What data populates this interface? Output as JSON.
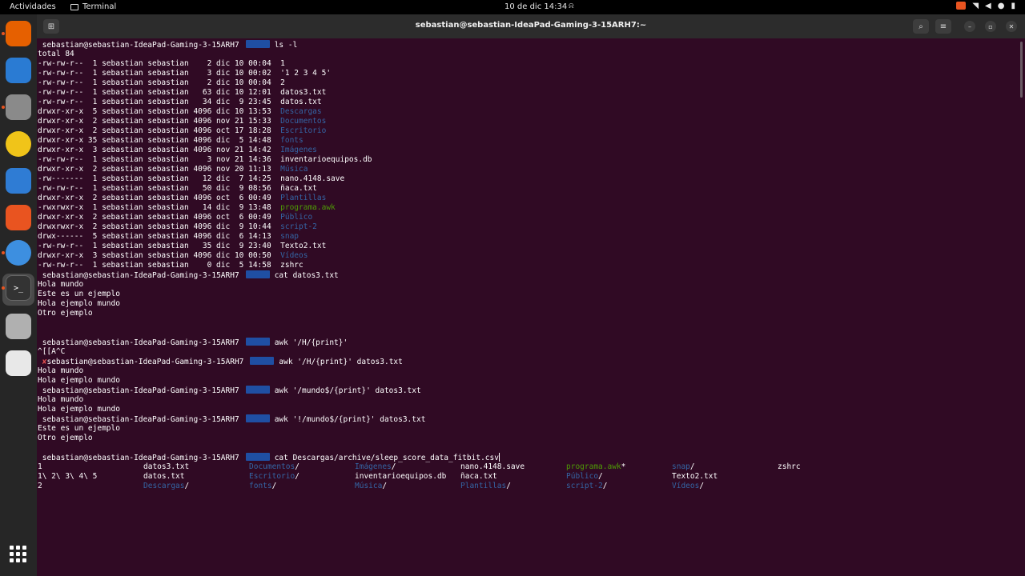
{
  "topbar": {
    "activities": "Actividades",
    "app_name": "Terminal",
    "clock": "10 de dic  14:34"
  },
  "window": {
    "title": "sebastian@sebastian-IdeaPad-Gaming-3-15ARH7:~"
  },
  "terminal": {
    "prompt": "sebastian@sebastian-IdeaPad-Gaming-3-15ARH7",
    "lines": [
      {
        "kind": "prompt",
        "cmd": "ls -l"
      },
      {
        "kind": "text",
        "text": "total 84"
      },
      {
        "kind": "ls",
        "meta": "-rw-rw-r--  1 sebastian sebastian    2 dic 10 00:04",
        "name": "1",
        "style": "plain"
      },
      {
        "kind": "ls",
        "meta": "-rw-rw-r--  1 sebastian sebastian    3 dic 10 00:02",
        "name": "'1 2 3 4 5'",
        "style": "plain"
      },
      {
        "kind": "ls",
        "meta": "-rw-rw-r--  1 sebastian sebastian    2 dic 10 00:04",
        "name": "2",
        "style": "plain"
      },
      {
        "kind": "ls",
        "meta": "-rw-rw-r--  1 sebastian sebastian   63 dic 10 12:01",
        "name": "datos3.txt",
        "style": "plain"
      },
      {
        "kind": "ls",
        "meta": "-rw-rw-r--  1 sebastian sebastian   34 dic  9 23:45",
        "name": "datos.txt",
        "style": "plain"
      },
      {
        "kind": "ls",
        "meta": "drwxr-xr-x  5 sebastian sebastian 4096 dic 10 13:53",
        "name": "Descargas",
        "style": "dir"
      },
      {
        "kind": "ls",
        "meta": "drwxr-xr-x  2 sebastian sebastian 4096 nov 21 15:33",
        "name": "Documentos",
        "style": "dir"
      },
      {
        "kind": "ls",
        "meta": "drwxr-xr-x  2 sebastian sebastian 4096 oct 17 18:28",
        "name": "Escritorio",
        "style": "dir"
      },
      {
        "kind": "ls",
        "meta": "drwxr-xr-x 35 sebastian sebastian 4096 dic  5 14:48",
        "name": "fonts",
        "style": "dir"
      },
      {
        "kind": "ls",
        "meta": "drwxr-xr-x  3 sebastian sebastian 4096 nov 21 14:42",
        "name": "Imágenes",
        "style": "dir"
      },
      {
        "kind": "ls",
        "meta": "-rw-rw-r--  1 sebastian sebastian    3 nov 21 14:36",
        "name": "inventarioequipos.db",
        "style": "plain"
      },
      {
        "kind": "ls",
        "meta": "drwxr-xr-x  2 sebastian sebastian 4096 nov 20 11:13",
        "name": "Música",
        "style": "dir"
      },
      {
        "kind": "ls",
        "meta": "-rw-------  1 sebastian sebastian   12 dic  7 14:25",
        "name": "nano.4148.save",
        "style": "plain"
      },
      {
        "kind": "ls",
        "meta": "-rw-rw-r--  1 sebastian sebastian   50 dic  9 08:56",
        "name": "ñaca.txt",
        "style": "plain"
      },
      {
        "kind": "ls",
        "meta": "drwxr-xr-x  2 sebastian sebastian 4096 oct  6 00:49",
        "name": "Plantillas",
        "style": "dir"
      },
      {
        "kind": "ls",
        "meta": "-rwxrwxr-x  1 sebastian sebastian   14 dic  9 13:48",
        "name": "programa.awk",
        "style": "exec"
      },
      {
        "kind": "ls",
        "meta": "drwxr-xr-x  2 sebastian sebastian 4096 oct  6 00:49",
        "name": "Público",
        "style": "dir"
      },
      {
        "kind": "ls",
        "meta": "drwxrwxr-x  2 sebastian sebastian 4096 dic  9 10:44",
        "name": "script-2",
        "style": "dir"
      },
      {
        "kind": "ls",
        "meta": "drwx------  5 sebastian sebastian 4096 dic  6 14:13",
        "name": "snap",
        "style": "dir"
      },
      {
        "kind": "ls",
        "meta": "-rw-rw-r--  1 sebastian sebastian   35 dic  9 23:40",
        "name": "Texto2.txt",
        "style": "plain"
      },
      {
        "kind": "ls",
        "meta": "drwxr-xr-x  3 sebastian sebastian 4096 dic 10 00:50",
        "name": "Vídeos",
        "style": "dir"
      },
      {
        "kind": "ls",
        "meta": "-rw-rw-r--  1 sebastian sebastian    0 dic  5 14:58",
        "name": "zshrc",
        "style": "plain"
      },
      {
        "kind": "prompt",
        "cmd": "cat datos3.txt"
      },
      {
        "kind": "text",
        "text": "Hola mundo"
      },
      {
        "kind": "text",
        "text": "Este es un ejemplo"
      },
      {
        "kind": "text",
        "text": "Hola ejemplo mundo"
      },
      {
        "kind": "text",
        "text": "Otro ejemplo"
      },
      {
        "kind": "blank"
      },
      {
        "kind": "blank"
      },
      {
        "kind": "prompt",
        "cmd": "awk '/H/{print}'"
      },
      {
        "kind": "text",
        "text": "^[[A^C"
      },
      {
        "kind": "prompt_err",
        "cmd": "awk '/H/{print}' datos3.txt"
      },
      {
        "kind": "text",
        "text": "Hola mundo"
      },
      {
        "kind": "text",
        "text": "Hola ejemplo mundo"
      },
      {
        "kind": "prompt",
        "cmd": "awk '/mundo$/{print}' datos3.txt"
      },
      {
        "kind": "text",
        "text": "Hola mundo"
      },
      {
        "kind": "text",
        "text": "Hola ejemplo mundo"
      },
      {
        "kind": "prompt",
        "cmd": "awk '!/mundo$/{print}' datos3.txt"
      },
      {
        "kind": "text",
        "text": "Este es un ejemplo"
      },
      {
        "kind": "text",
        "text": "Otro ejemplo"
      },
      {
        "kind": "blank"
      },
      {
        "kind": "prompt",
        "cmd": "cat Descargas/archive/sleep_score_data_fitbit.csv",
        "cursor": true
      }
    ],
    "completions": [
      [
        {
          "text": "1",
          "style": "plain"
        },
        {
          "text": "datos3.txt",
          "style": "plain"
        },
        {
          "text": "Documentos",
          "style": "dir",
          "suffix": "/"
        },
        {
          "text": "Imágenes",
          "style": "dir",
          "suffix": "/"
        },
        {
          "text": "nano.4148.save",
          "style": "plain"
        },
        {
          "text": "programa.awk",
          "style": "exec",
          "suffix": "*"
        },
        {
          "text": "snap",
          "style": "dir",
          "suffix": "/"
        },
        {
          "text": "zshrc",
          "style": "plain"
        }
      ],
      [
        {
          "text": "1\\ 2\\ 3\\ 4\\ 5",
          "style": "plain"
        },
        {
          "text": "datos.txt",
          "style": "plain"
        },
        {
          "text": "Escritorio",
          "style": "dir",
          "suffix": "/"
        },
        {
          "text": "inventarioequipos.db",
          "style": "plain"
        },
        {
          "text": "ñaca.txt",
          "style": "plain"
        },
        {
          "text": "Público",
          "style": "dir",
          "suffix": "/"
        },
        {
          "text": "Texto2.txt",
          "style": "plain"
        }
      ],
      [
        {
          "text": "2",
          "style": "plain"
        },
        {
          "text": "Descargas",
          "style": "dir",
          "suffix": "/"
        },
        {
          "text": "fonts",
          "style": "dir",
          "suffix": "/"
        },
        {
          "text": "Música",
          "style": "dir",
          "suffix": "/"
        },
        {
          "text": "Plantillas",
          "style": "dir",
          "suffix": "/"
        },
        {
          "text": "script-2",
          "style": "dir",
          "suffix": "/"
        },
        {
          "text": "Vídeos",
          "style": "dir",
          "suffix": "/"
        }
      ]
    ]
  },
  "dock": {
    "items": [
      {
        "name": "firefox-icon",
        "color": "#e66000",
        "running": true
      },
      {
        "name": "thunderbird-icon",
        "color": "#2a7bd3",
        "running": false
      },
      {
        "name": "files-icon",
        "color": "#8a8a8a",
        "running": true
      },
      {
        "name": "rhythmbox-icon",
        "color": "#f0c419",
        "running": false
      },
      {
        "name": "writer-icon",
        "color": "#2f7cd4",
        "running": false
      },
      {
        "name": "app-center-icon",
        "color": "#e95420",
        "running": false
      },
      {
        "name": "help-icon",
        "color": "#3d8fe0",
        "running": true
      },
      {
        "name": "terminal-icon",
        "color": "#333333",
        "running": true
      },
      {
        "name": "ssd-drive-icon",
        "color": "#b0b0b0",
        "running": false
      },
      {
        "name": "trash-icon",
        "color": "#e8e8e8",
        "running": false
      }
    ],
    "apps_grid": "apps-grid-icon"
  },
  "colors": {
    "terminal_bg": "#300a24",
    "dir": "#3465a4",
    "exec": "#4e9a06",
    "prompt_badge": "#1f4fa3"
  }
}
